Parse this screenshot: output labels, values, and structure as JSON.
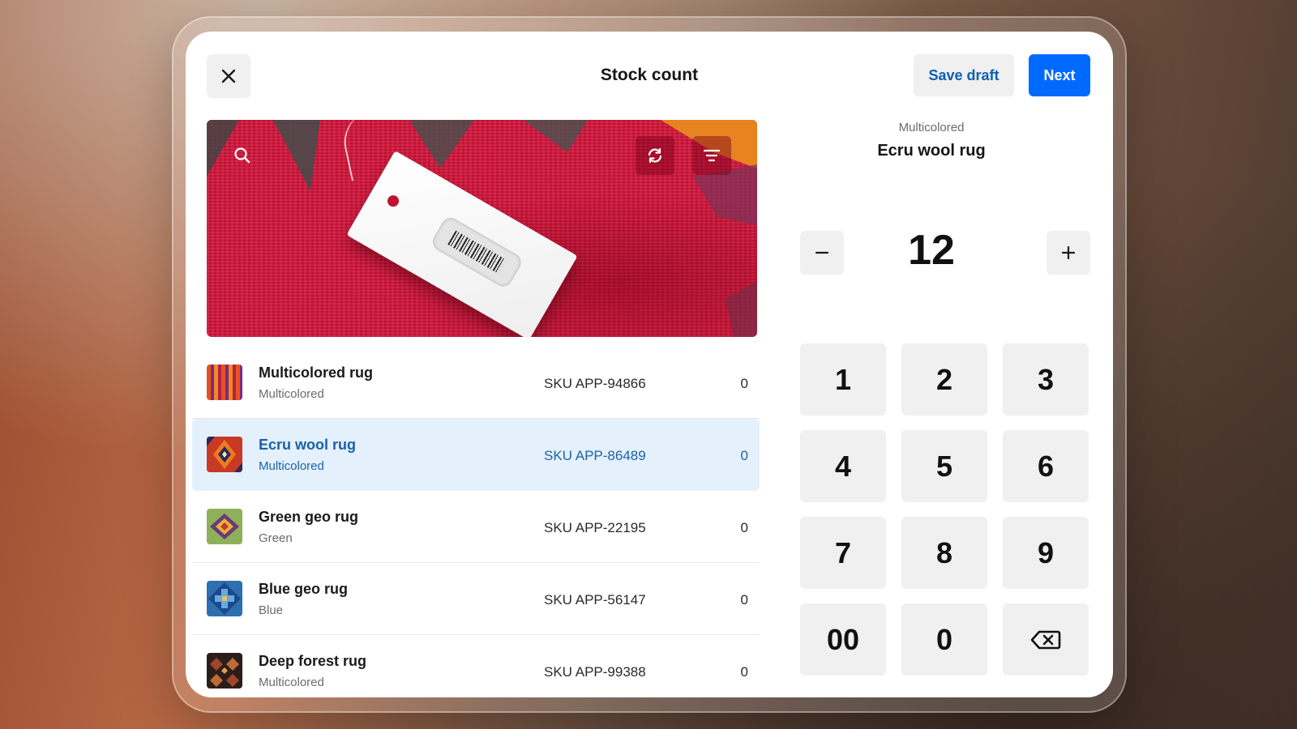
{
  "header": {
    "title": "Stock count",
    "close_icon": "close-icon",
    "save_draft_label": "Save draft",
    "next_label": "Next"
  },
  "scanner": {
    "icons": [
      "search-icon",
      "camera-flip-icon",
      "filter-icon"
    ]
  },
  "items": [
    {
      "name": "Multicolored rug",
      "variant": "Multicolored",
      "sku": "SKU APP-94866",
      "count": "0",
      "selected": false
    },
    {
      "name": "Ecru wool rug",
      "variant": "Multicolored",
      "sku": "SKU APP-86489",
      "count": "0",
      "selected": true
    },
    {
      "name": "Green geo rug",
      "variant": "Green",
      "sku": "SKU APP-22195",
      "count": "0",
      "selected": false
    },
    {
      "name": "Blue geo rug",
      "variant": "Blue",
      "sku": "SKU APP-56147",
      "count": "0",
      "selected": false
    },
    {
      "name": "Deep forest rug",
      "variant": "Multicolored",
      "sku": "SKU APP-99388",
      "count": "0",
      "selected": false
    }
  ],
  "selected_item": {
    "variant": "Multicolored",
    "name": "Ecru wool rug",
    "quantity": "12"
  },
  "keypad": {
    "keys": [
      "1",
      "2",
      "3",
      "4",
      "5",
      "6",
      "7",
      "8",
      "9",
      "00",
      "0"
    ],
    "backspace_icon": "backspace-icon"
  },
  "colors": {
    "accent": "#006aff",
    "accent_text": "#0a5fb3",
    "selected_row": "#e4f0fc",
    "selected_text": "#1a62a8"
  }
}
